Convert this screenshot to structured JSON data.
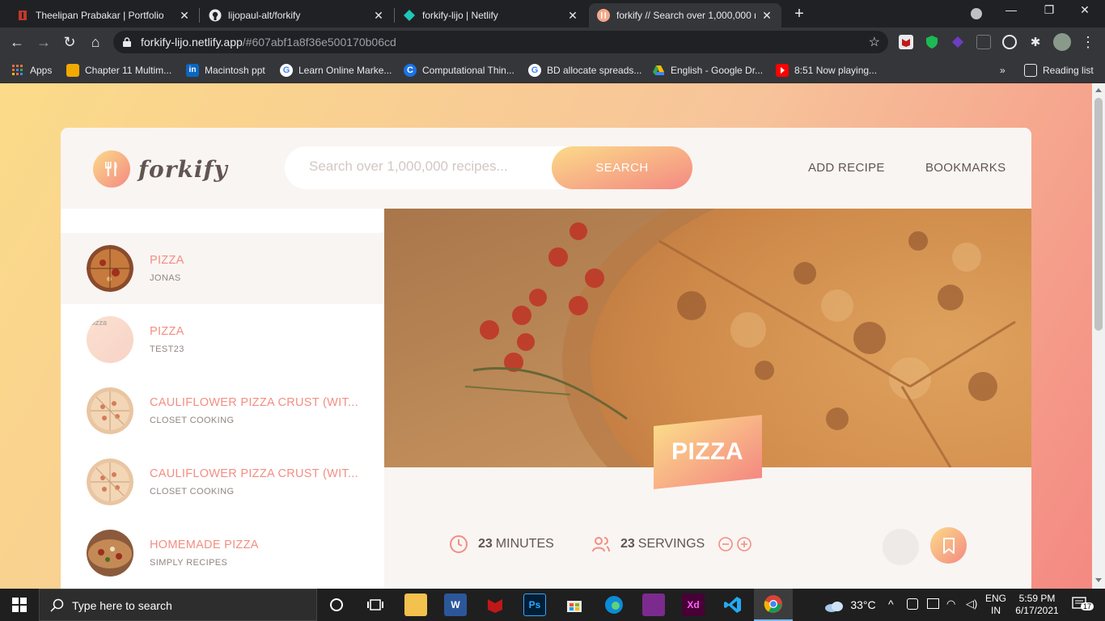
{
  "browser": {
    "tabs": [
      {
        "title": "Theelipan Prabakar | Portfolio",
        "active": false
      },
      {
        "title": "lijopaul-alt/forkify",
        "active": false
      },
      {
        "title": "forkify-lijo | Netlify",
        "active": false
      },
      {
        "title": "forkify // Search over 1,000,000 r",
        "active": true
      }
    ],
    "url_host": "forkify-lijo.netlify.app",
    "url_path": "/#607abf1a8f36e500170b06cd",
    "bookmarks": [
      "Apps",
      "Chapter 11 Multim...",
      "Macintosh ppt",
      "Learn Online Marke...",
      "Computational Thin...",
      "BD allocate spreads...",
      "English - Google Dr...",
      "8:51 Now playing..."
    ],
    "bookmarks_more": "»",
    "reading_list": "Reading list"
  },
  "app": {
    "logo_text": "forkify",
    "search_placeholder": "Search over 1,000,000 recipes...",
    "search_button": "SEARCH",
    "nav": {
      "add_recipe": "ADD RECIPE",
      "bookmarks": "BOOKMARKS"
    },
    "results": [
      {
        "title": "PIZZA",
        "publisher": "JONAS",
        "active": true
      },
      {
        "title": "PIZZA",
        "publisher": "TEST23",
        "active": false,
        "broken_image_alt": "pizza"
      },
      {
        "title": "CAULIFLOWER PIZZA CRUST (WIT...",
        "publisher": "CLOSET COOKING",
        "active": false
      },
      {
        "title": "CAULIFLOWER PIZZA CRUST (WIT...",
        "publisher": "CLOSET COOKING",
        "active": false
      },
      {
        "title": "HOMEMADE PIZZA",
        "publisher": "SIMPLY RECIPES",
        "active": false
      }
    ],
    "recipe": {
      "title": "PIZZA",
      "minutes": "23",
      "minutes_label": "MINUTES",
      "servings": "23",
      "servings_label": "SERVINGS"
    },
    "colors": {
      "primary_light": "#fbdb89",
      "primary_dark": "#f48982",
      "text": "#615551",
      "grey_light": "#f9f5f3"
    }
  },
  "taskbar": {
    "search_placeholder": "Type here to search",
    "weather": "33°C",
    "lang_top": "ENG",
    "lang_bottom": "IN",
    "time": "5:59 PM",
    "date": "6/17/2021",
    "notifications": "17"
  }
}
